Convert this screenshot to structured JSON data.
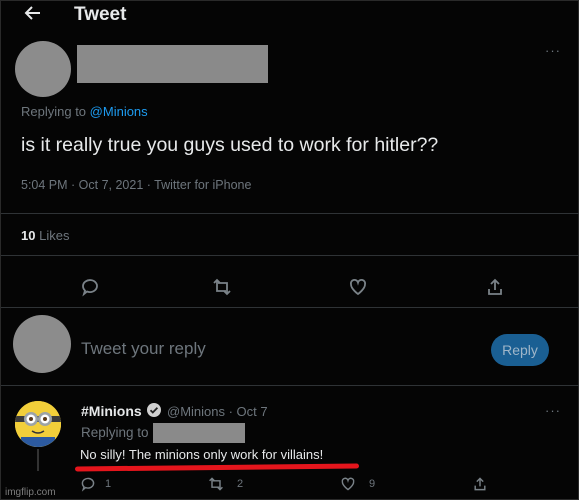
{
  "header": {
    "back_icon": "arrow-left-icon",
    "title": "Tweet"
  },
  "main_tweet": {
    "replying_prefix": "Replying to",
    "replying_mention": "@Minions",
    "text": "is it really true you guys used to work for hitler??",
    "meta": "5:04 PM · Oct 7, 2021 · Twitter for iPhone",
    "likes_count": "10",
    "likes_label": "Likes",
    "more_icon": "more-dots-icon"
  },
  "actions": {
    "reply_icon": "reply-icon",
    "retweet_icon": "retweet-icon",
    "like_icon": "heart-icon",
    "share_icon": "share-icon"
  },
  "composer": {
    "placeholder": "Tweet your reply",
    "button_label": "Reply"
  },
  "reply_tweet": {
    "name": "#Minions",
    "handle_date": "@Minions · Oct 7",
    "replying_prefix": "Replying to",
    "text": "No silly! The minions only work for villains!",
    "reply_count": "1",
    "retweet_count": "2",
    "like_count": "9"
  },
  "watermark": "imgflip.com",
  "colors": {
    "accent": "#1d9bf0",
    "underline": "#e5151c",
    "background": "#000000"
  }
}
